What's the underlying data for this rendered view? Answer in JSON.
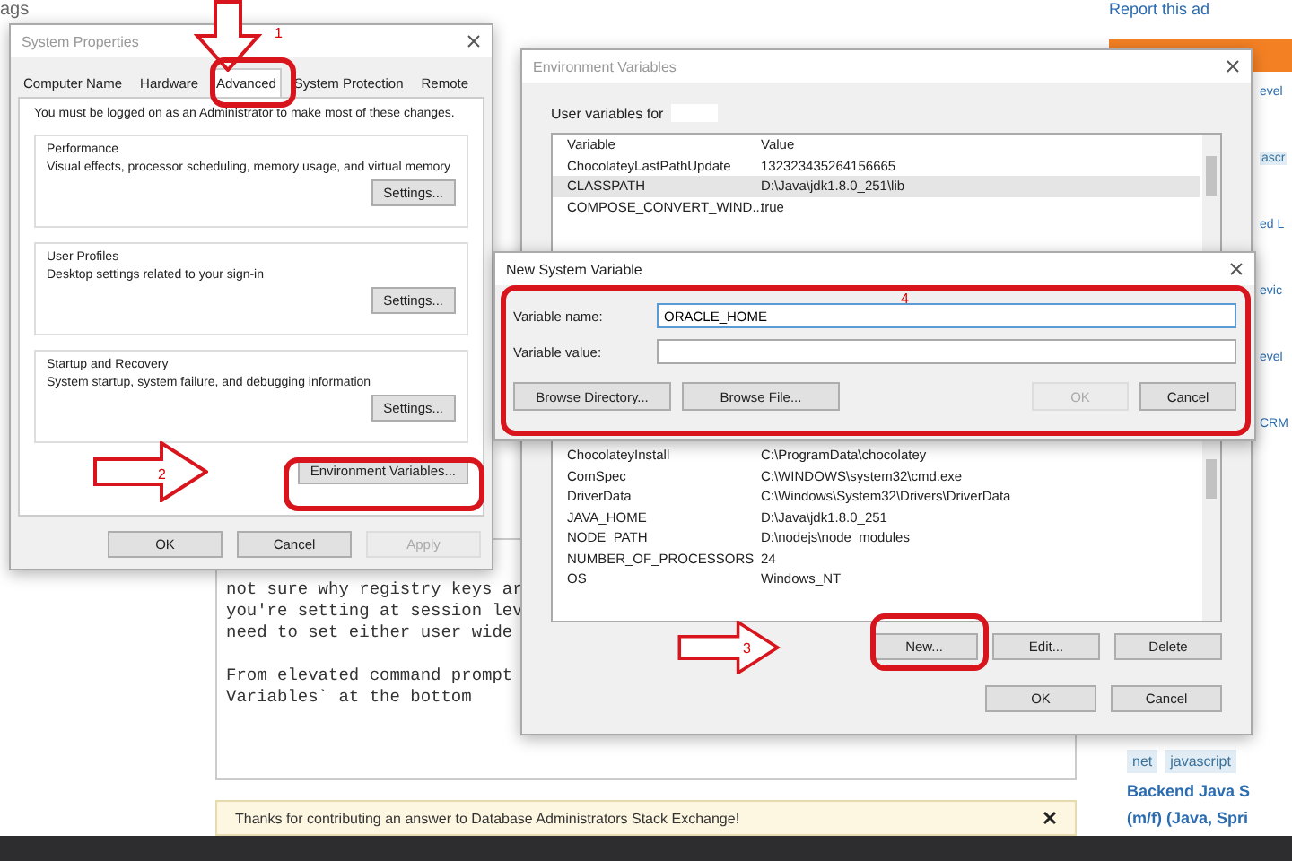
{
  "background_page": {
    "top_label": "ags",
    "report_ad": "Report this ad",
    "code_paragraphs": [
      [
        "not sure why registry keys ar",
        "you're setting at session lev",
        "need to set either user wide"
      ],
      [
        "From elevated command prompt",
        "Variables` at the bottom"
      ]
    ],
    "notice": "Thanks for contributing an answer to Database Administrators Stack Exchange!",
    "sidebar_items": [
      {
        "kind": "link",
        "text": "evel"
      },
      {
        "kind": "tag",
        "text": "ascr"
      },
      {
        "kind": "link",
        "text": "ed L"
      },
      {
        "kind": "link",
        "text": "evic"
      },
      {
        "kind": "link",
        "text": "evel"
      },
      {
        "kind": "link",
        "text": "CRM"
      }
    ],
    "tags": [
      "net",
      "javascript"
    ],
    "job_title": "Backend Java S",
    "job_subtitle": "(m/f) (Java, Spri"
  },
  "system_properties": {
    "title": "System Properties",
    "tabs": [
      {
        "label": "Computer Name",
        "selected": false
      },
      {
        "label": "Hardware",
        "selected": false
      },
      {
        "label": "Advanced",
        "selected": true
      },
      {
        "label": "System Protection",
        "selected": false
      },
      {
        "label": "Remote",
        "selected": false
      }
    ],
    "notice": "You must be logged on as an Administrator to make most of these changes.",
    "groups": [
      {
        "title": "Performance",
        "description": "Visual effects, processor scheduling, memory usage, and virtual memory",
        "button": "Settings..."
      },
      {
        "title": "User Profiles",
        "description": "Desktop settings related to your sign-in",
        "button": "Settings..."
      },
      {
        "title": "Startup and Recovery",
        "description": "System startup, system failure, and debugging information",
        "button": "Settings..."
      }
    ],
    "env_button": "Environment Variables...",
    "buttons": [
      {
        "label": "OK",
        "disabled": false
      },
      {
        "label": "Cancel",
        "disabled": false
      },
      {
        "label": "Apply",
        "disabled": true
      }
    ]
  },
  "environment_variables": {
    "title": "Environment Variables",
    "user_label": "User variables for",
    "columns": [
      "Variable",
      "Value"
    ],
    "user_rows": [
      {
        "variable": "ChocolateyLastPathUpdate",
        "value": "132323435264156665",
        "selected": false
      },
      {
        "variable": "CLASSPATH",
        "value": "D:\\Java\\jdk1.8.0_251\\lib",
        "selected": true
      },
      {
        "variable": "COMPOSE_CONVERT_WIND...",
        "value": "true",
        "selected": false
      }
    ],
    "system_rows": [
      {
        "variable": "ChocolateyInstall",
        "value": "C:\\ProgramData\\chocolatey",
        "selected": false
      },
      {
        "variable": "ComSpec",
        "value": "C:\\WINDOWS\\system32\\cmd.exe",
        "selected": false
      },
      {
        "variable": "DriverData",
        "value": "C:\\Windows\\System32\\Drivers\\DriverData",
        "selected": false
      },
      {
        "variable": "JAVA_HOME",
        "value": "D:\\Java\\jdk1.8.0_251",
        "selected": false
      },
      {
        "variable": "NODE_PATH",
        "value": "D:\\nodejs\\node_modules",
        "selected": false
      },
      {
        "variable": "NUMBER_OF_PROCESSORS",
        "value": "24",
        "selected": false
      },
      {
        "variable": "OS",
        "value": "Windows_NT",
        "selected": false
      }
    ],
    "system_buttons": [
      "New...",
      "Edit...",
      "Delete"
    ],
    "buttons": [
      {
        "label": "OK",
        "disabled": false
      },
      {
        "label": "Cancel",
        "disabled": false
      }
    ]
  },
  "new_system_variable": {
    "title": "New System Variable",
    "fields": [
      {
        "label": "Variable name:",
        "value": "ORACLE_HOME",
        "focused": true
      },
      {
        "label": "Variable value:",
        "focused": false
      }
    ],
    "browse_buttons": [
      "Browse Directory...",
      "Browse File..."
    ],
    "buttons": [
      {
        "label": "OK",
        "disabled": true
      },
      {
        "label": "Cancel",
        "disabled": false
      }
    ]
  },
  "annotations": [
    {
      "number": "1",
      "kind": "arrow-down"
    },
    {
      "number": "2",
      "kind": "arrow-right"
    },
    {
      "number": "3",
      "kind": "arrow-right"
    },
    {
      "number": "4",
      "kind": "none"
    }
  ]
}
